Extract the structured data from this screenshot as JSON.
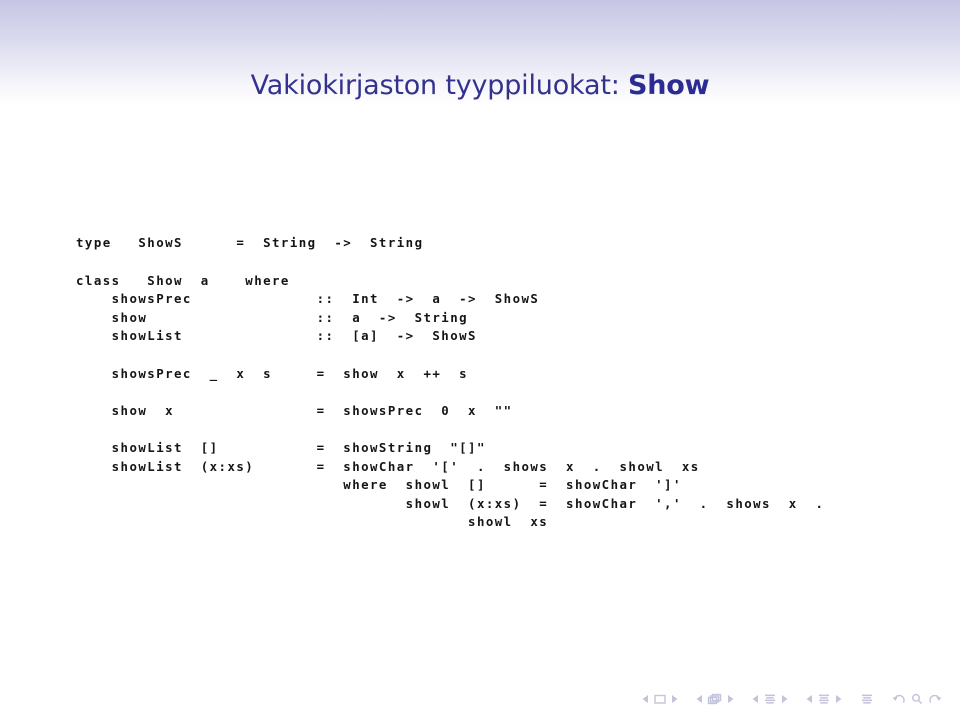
{
  "slide": {
    "title_plain": "Vakiokirjaston tyyppiluokat: ",
    "title_strong": "Show",
    "title_color": "#33338e",
    "header_gradient_top": "#c6c6e4",
    "header_gradient_bottom": "#ffffff",
    "code_color": "#151515"
  },
  "code": {
    "language": "haskell",
    "lines": [
      "type   ShowS      =  String  ->  String",
      "",
      "class   Show  a    where",
      "    showsPrec              ::  Int  ->  a  ->  ShowS",
      "    show                   ::  a  ->  String",
      "    showList               ::  [a]  ->  ShowS",
      "",
      "    showsPrec  _  x  s     =  show  x  ++  s",
      "",
      "    show  x                =  showsPrec  0  x  \"\"",
      "",
      "    showList  []           =  showString  \"[]\"",
      "    showList  (x:xs)       =  showChar  '['  .  shows  x  .  showl  xs",
      "                              where  showl  []      =  showChar  ']'",
      "                                     showl  (x:xs)  =  showChar  ','  .  shows  x  .",
      "                                            showl  xs"
    ]
  },
  "navigation": {
    "color": "#c3c3dc",
    "groups": [
      {
        "name": "slide-navigation",
        "prev_label": "Previous slide",
        "center_label": "Slide",
        "next_label": "Next slide"
      },
      {
        "name": "frame-navigation",
        "prev_label": "Previous frame",
        "center_label": "Frame",
        "next_label": "Next frame"
      },
      {
        "name": "subsection-navigation",
        "prev_label": "Previous subsection",
        "center_label": "Subsection",
        "next_label": "Next subsection"
      },
      {
        "name": "section-navigation",
        "prev_label": "Previous section",
        "center_label": "Section",
        "next_label": "Next section"
      }
    ],
    "presentation_label": "Presentation",
    "back_label": "Back",
    "search_label": "Search",
    "forward_label": "Forward"
  }
}
